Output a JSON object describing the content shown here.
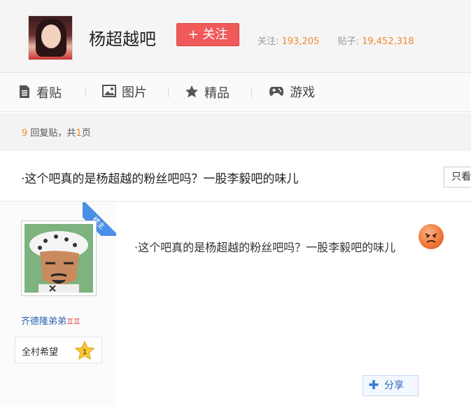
{
  "forum": {
    "name": "杨超越吧",
    "follow_label": "+ 关注",
    "followers_label": "关注:",
    "followers": "193,205",
    "posts_label": "贴子:",
    "posts": "19,452,318"
  },
  "nav": {
    "tabs": [
      {
        "label": "看贴",
        "icon": "document-icon"
      },
      {
        "label": "图片",
        "icon": "image-icon"
      },
      {
        "label": "精品",
        "icon": "star-icon"
      },
      {
        "label": "游戏",
        "icon": "gamepad-icon"
      }
    ]
  },
  "thread": {
    "reply_count": "9",
    "reply_label": "回复贴，共",
    "page_count": "1",
    "page_label": "页",
    "title": "·这个吧真的是杨超越的粉丝吧吗？一股李毅吧的味儿",
    "only_label": "只看"
  },
  "post": {
    "badge": "楼主",
    "author": "齐德隆弟弟",
    "author_marks": "♊♊",
    "level_title": "全村希望",
    "level": "1",
    "content": "·这个吧真的是杨超越的粉丝吧吗？一股李毅吧的味儿",
    "share_label": "分享"
  },
  "colors": {
    "accent": "#f08b2c",
    "follow": "#f05a5a",
    "link": "#2d64b3"
  }
}
